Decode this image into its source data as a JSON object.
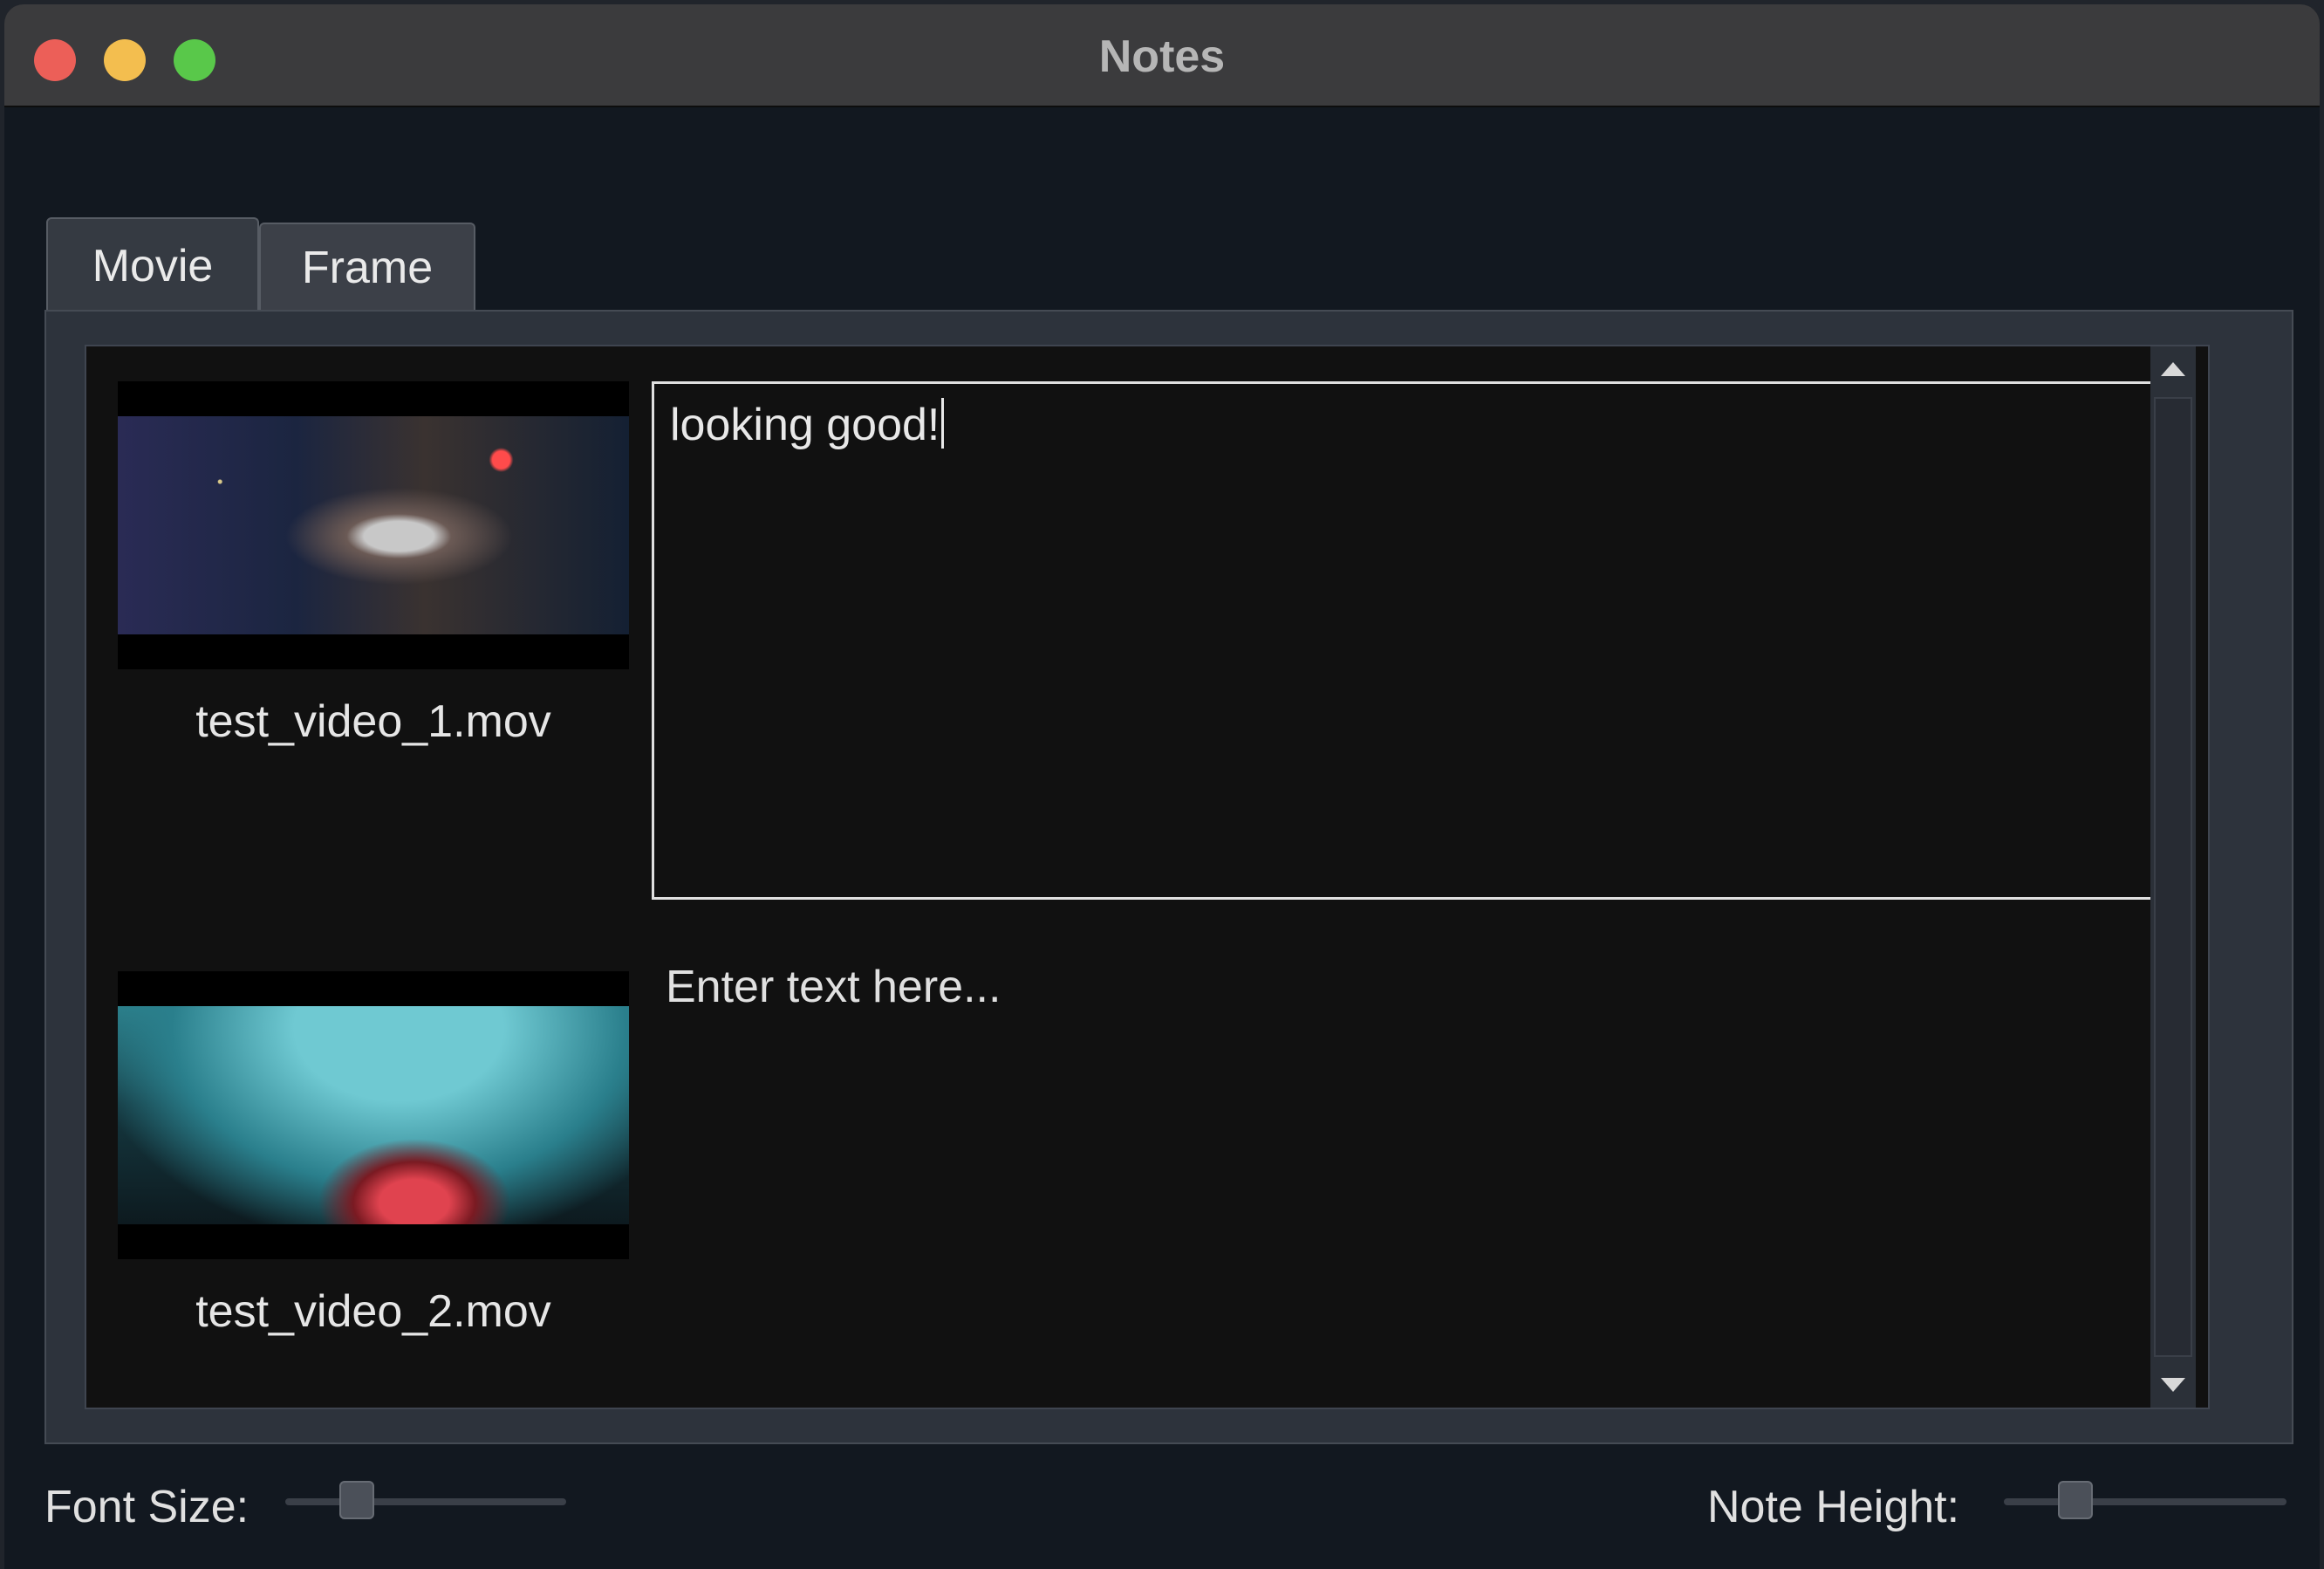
{
  "window": {
    "title": "Notes"
  },
  "tabs": [
    {
      "label": "Movie",
      "active": true
    },
    {
      "label": "Frame",
      "active": false
    }
  ],
  "notes": [
    {
      "filename": "test_video_1.mov",
      "text": "looking good!",
      "placeholder": "Enter text here..."
    },
    {
      "filename": "test_video_2.mov",
      "text": "",
      "placeholder": "Enter text here..."
    }
  ],
  "footer": {
    "font_size_label": "Font Size:",
    "note_height_label": "Note Height:",
    "font_size_level": 0.22,
    "note_height_level": 0.22
  }
}
